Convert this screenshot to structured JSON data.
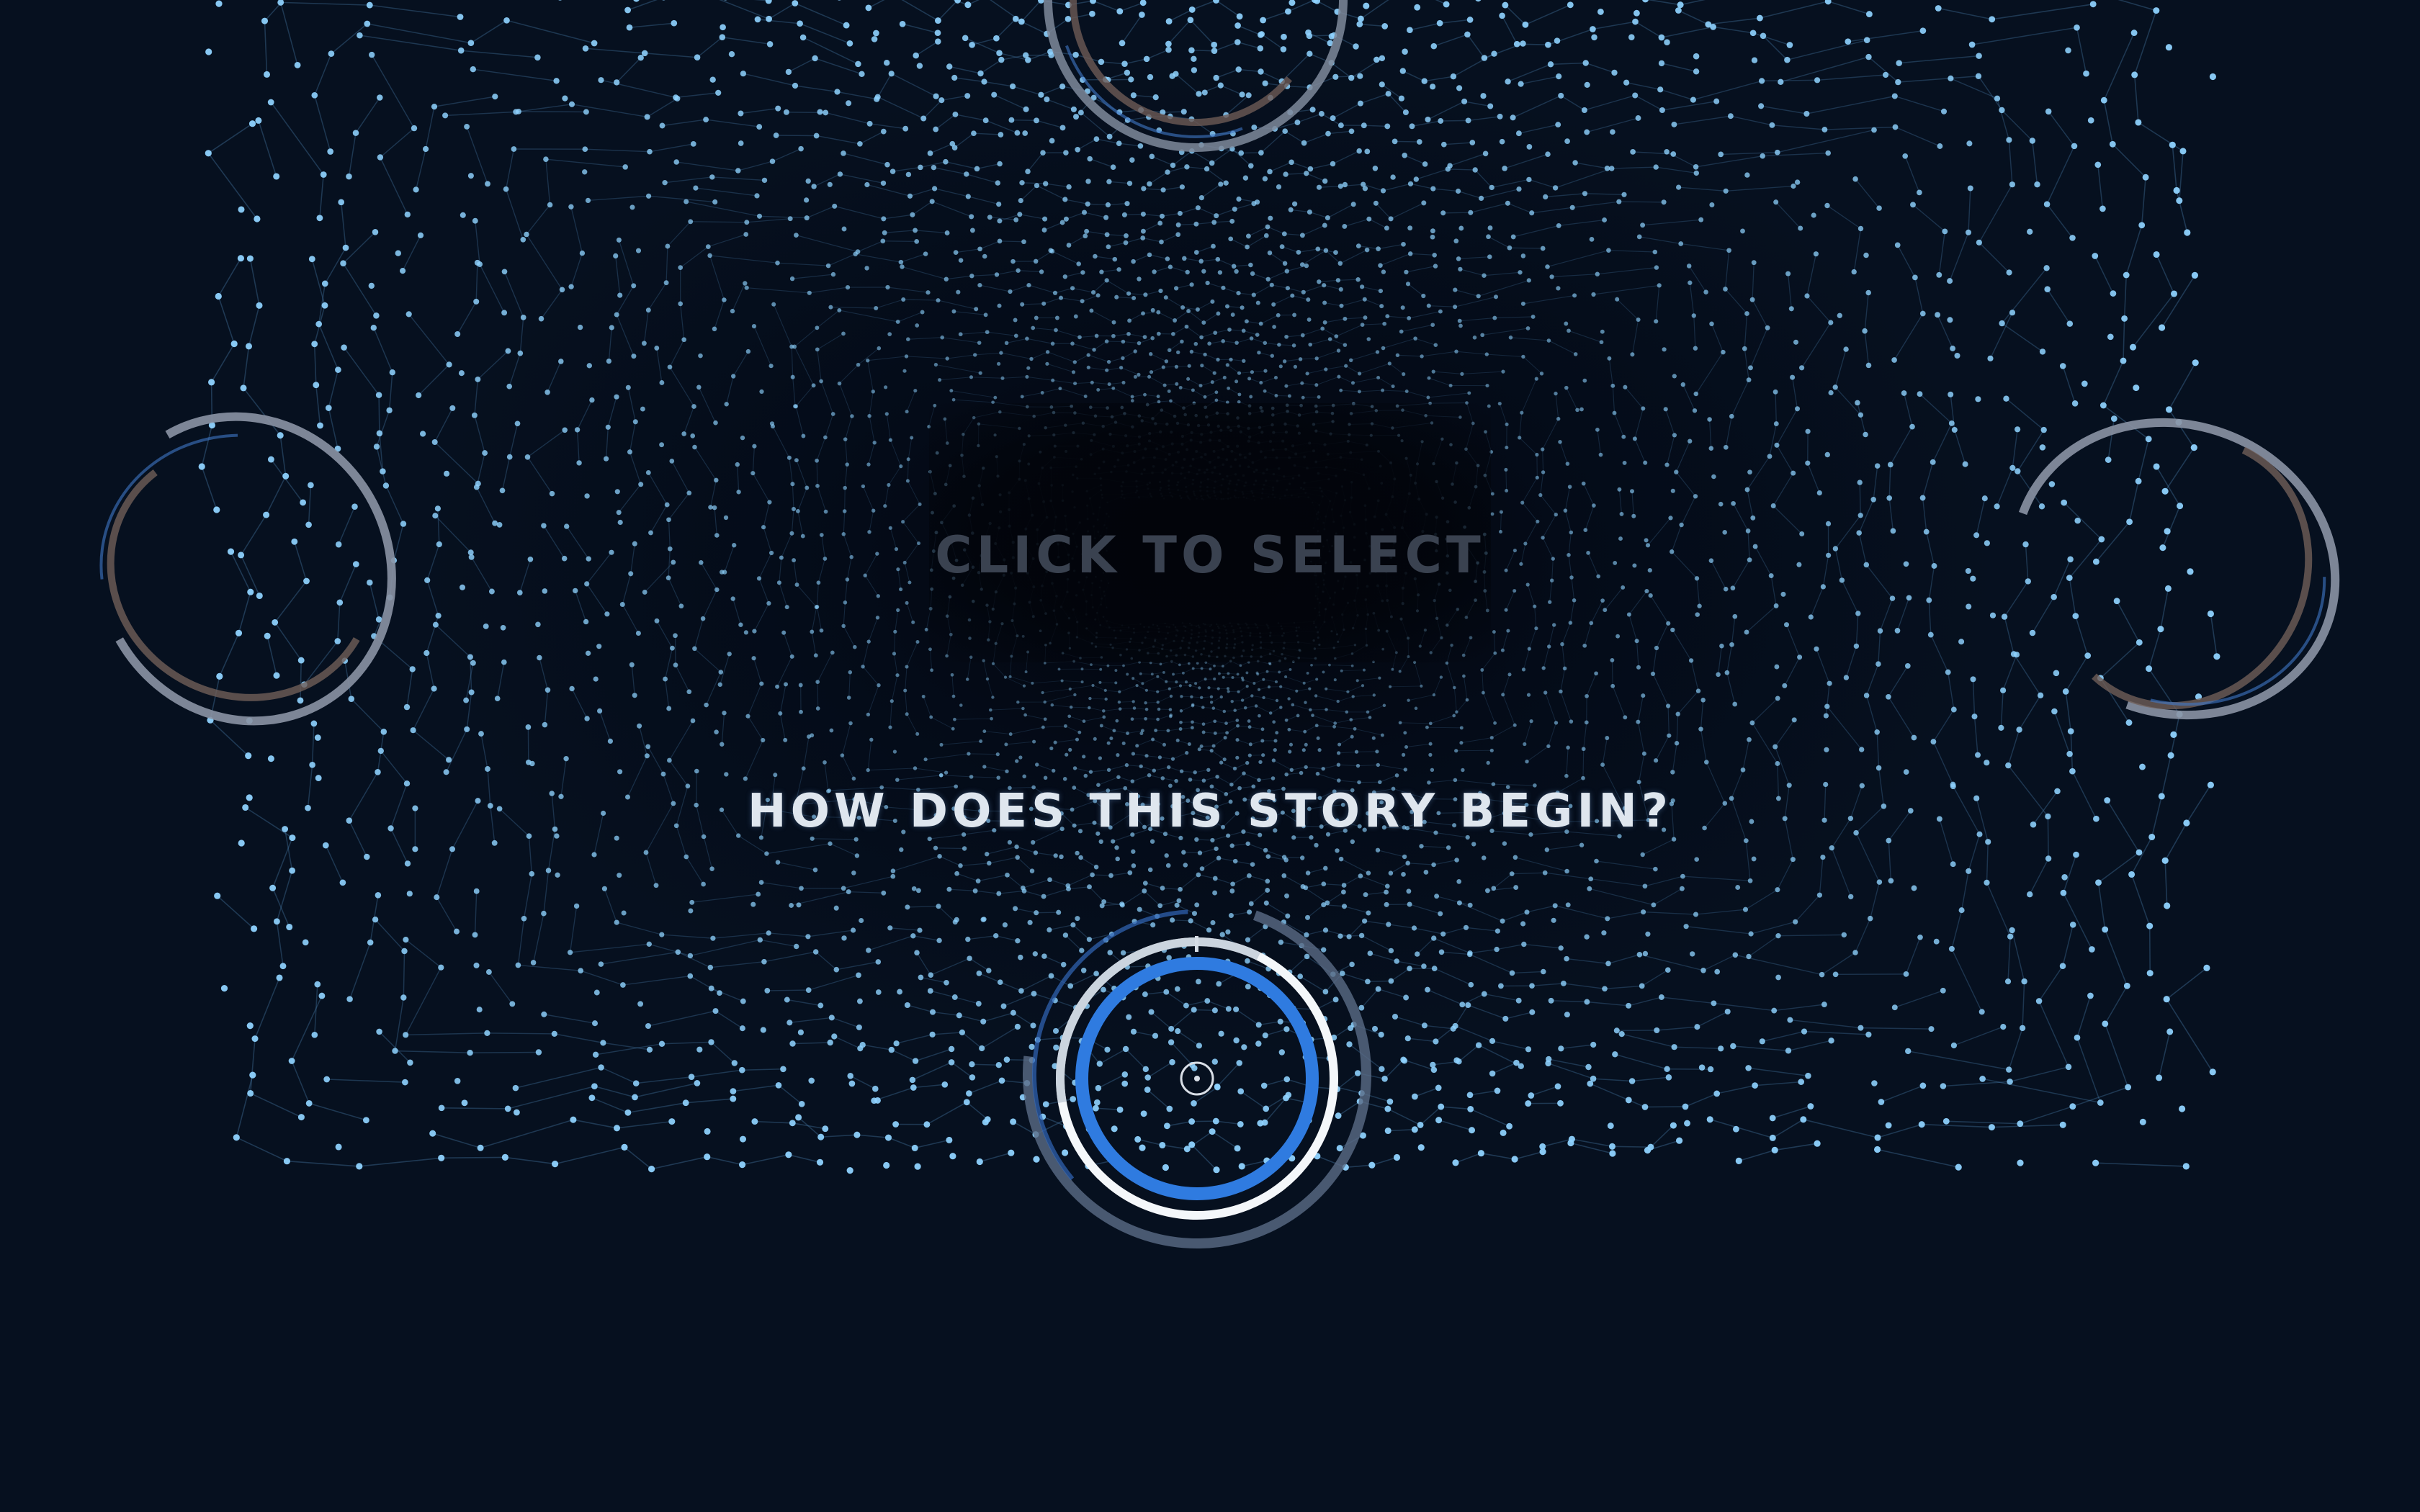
{
  "hint": {
    "text": "CLICK TO SELECT"
  },
  "prompt": {
    "question": "HOW DOES THIS STORY BEGIN?"
  },
  "icons": {
    "option_rings": [
      "option-ring-top",
      "option-ring-left",
      "option-ring-right"
    ],
    "selector": "selection-ring-icon",
    "cursor": "cursor-reticle-icon"
  },
  "colors": {
    "background": "#030812",
    "particles": "#8fd3ff",
    "accent_blue": "#2f7be0",
    "ring_white": "#f4f7fa",
    "ring_grey": "#8d96a6",
    "hint_text": "#3a4250",
    "question_text": "#dfe6ee"
  },
  "selector": {
    "progress": 1.0
  }
}
